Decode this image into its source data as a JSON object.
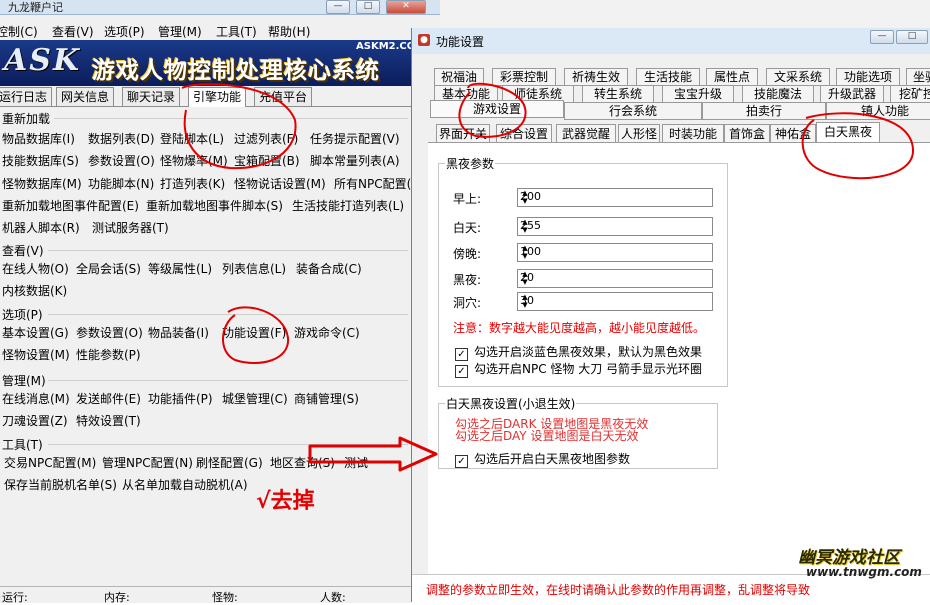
{
  "main": {
    "title": "九龙鞭户记",
    "menu": [
      "控制(C)",
      "查看(V)",
      "选项(P)",
      "管理(M)",
      "工具(T)",
      "帮助(H)"
    ],
    "banner": {
      "logo": "ASK",
      "system": "游戏人物控制处理核心系统",
      "site": "ASKM2.COM"
    },
    "tabs": [
      "运行日志",
      "网关信息",
      "聊天记录",
      "引擎功能",
      "充值平台"
    ],
    "active_tab": "引擎功能",
    "groups": {
      "reload": {
        "title": "重新加载",
        "items": [
          "物品数据库(I)",
          "数据列表(D)",
          "登陆脚本(L)",
          "过滤列表(F)",
          "任务提示配置(V)",
          "技能数据库(S)",
          "参数设置(O)",
          "怪物爆率(M)",
          "宝箱配置(B)",
          "脚本常量列表(A)",
          "怪物数据库(M)",
          "功能脚本(N)",
          "打造列表(K)",
          "怪物说话设置(M)",
          "所有NPC配置(N)",
          "重新加载地图事件配置(E)",
          "重新加载地图事件脚本(S)",
          "生活技能打造列表(L)",
          "机器人脚本(R)",
          "测试服务器(T)"
        ]
      },
      "view": {
        "title": "查看(V)",
        "items": [
          "在线人物(O)",
          "全局会话(S)",
          "等级属性(L)",
          "列表信息(L)",
          "装备合成(C)",
          "内核数据(K)"
        ]
      },
      "options": {
        "title": "选项(P)",
        "items": [
          "基本设置(G)",
          "参数设置(O)",
          "物品装备(I)",
          "功能设置(F)",
          "游戏命令(C)",
          "怪物设置(M)",
          "性能参数(P)"
        ]
      },
      "manage": {
        "title": "管理(M)",
        "items": [
          "在线消息(M)",
          "发送邮件(E)",
          "功能插件(P)",
          "城堡管理(C)",
          "商铺管理(S)",
          "刀魂设置(Z)",
          "特效设置(T)"
        ]
      },
      "tools": {
        "title": "工具(T)",
        "items": [
          "交易NPC配置(M)",
          "管理NPC配置(N)",
          "刷怪配置(G)",
          "地区查询(S)",
          "测试",
          "保存当前脱机名单(S)",
          "从名单加载自动脱机(A)"
        ]
      }
    },
    "status": [
      "运行:",
      "内存:",
      "怪物:",
      "人数:"
    ],
    "remove_note": "√去掉"
  },
  "dialog": {
    "title": "功能设置",
    "tabs_row1": [
      "祝福油",
      "彩票控制",
      "祈祷生效",
      "生活技能",
      "属性点",
      "文采系统",
      "功能选项",
      "坐骑"
    ],
    "tabs_row2": [
      "基本功能",
      "师徒系统",
      "转生系统",
      "宝宝升级",
      "技能魔法",
      "升级武器",
      "挖矿控"
    ],
    "tabs_row3": [
      "游戏设置",
      "行会系统",
      "拍卖行",
      "镇人功能"
    ],
    "subtabs": [
      "界面开关",
      "综合设置",
      "武器觉醒",
      "人形怪",
      "时装功能",
      "首饰盒",
      "神佑盒",
      "白天黑夜"
    ],
    "active_subtab": "白天黑夜",
    "night_group": {
      "title": "黑夜参数",
      "fields": [
        {
          "label": "早上:",
          "value": "200"
        },
        {
          "label": "白天:",
          "value": "255"
        },
        {
          "label": "傍晚:",
          "value": "100"
        },
        {
          "label": "黑夜:",
          "value": "20"
        },
        {
          "label": "洞穴:",
          "value": "30"
        }
      ],
      "note": "注意：数字越大能见度越高，越小能见度越低。",
      "checks": [
        {
          "label": "勾选开启淡蓝色黑夜效果，默认为黑色效果",
          "checked": true
        },
        {
          "label": "勾选开启NPC 怪物 大刀 弓箭手显示光环圈",
          "checked": true
        }
      ]
    },
    "day_group": {
      "title": "白天黑夜设置(小退生效)",
      "notes": [
        "勾选之后DARK 设置地图是黑夜无效",
        "勾选之后DAY  设置地图是白天无效"
      ],
      "check": {
        "label": "勾选后开启白天黑夜地图参数",
        "checked": true
      }
    },
    "bottom_note": "调整的参数立即生效，在线时请确认此参数的作用再调整，乱调整将导致",
    "watermark": "幽冥游戏社区",
    "watermark_url": "www.tnwgm.com"
  },
  "colors": {
    "banner": "#1b3a8a",
    "annotation": "#e00000",
    "note": "#e60000"
  }
}
